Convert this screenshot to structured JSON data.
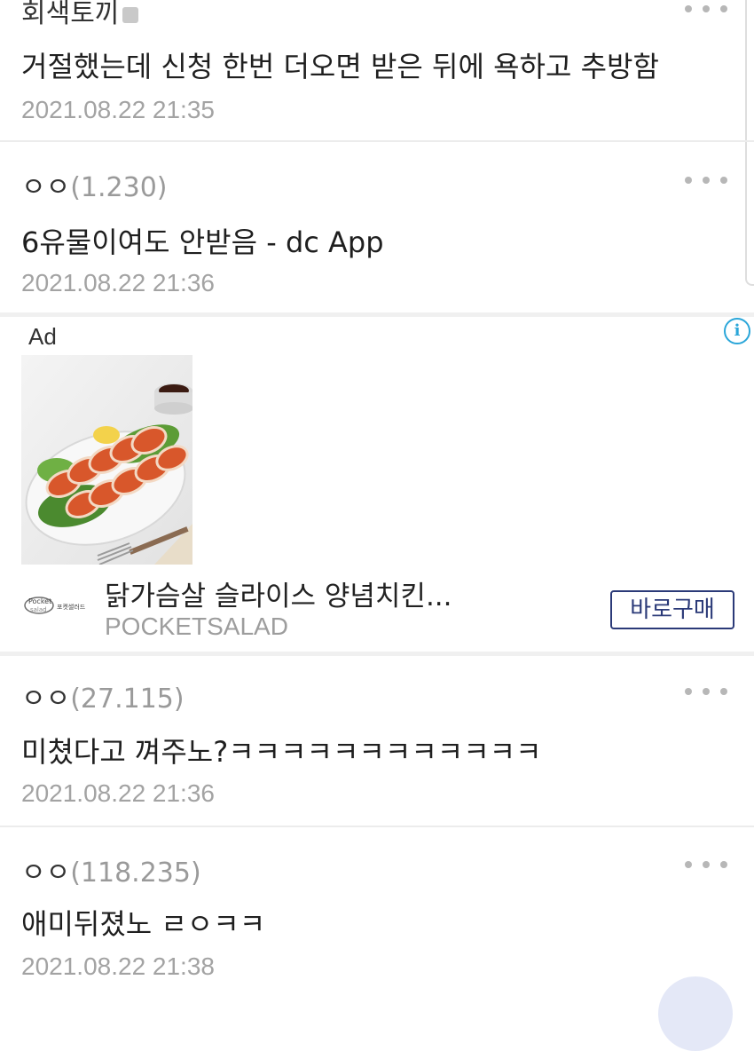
{
  "comments": [
    {
      "author": "회색토끼",
      "ip": "",
      "text": "거절했는데 신청 한번 더오면 받은 뒤에 욕하고 추방함",
      "date": "2021.08.22 21:35"
    },
    {
      "author": "ㅇㅇ",
      "ip": "(1.230)",
      "text": "6유물이여도 안받음 - dc App",
      "date": "2021.08.22 21:36"
    },
    {
      "author": "ㅇㅇ",
      "ip": "(27.115)",
      "text": "미쳤다고 껴주노?ㅋㅋㅋㅋㅋㅋㅋㅋㅋㅋㅋㅋ",
      "date": "2021.08.22 21:36"
    },
    {
      "author": "ㅇㅇ",
      "ip": "(118.235)",
      "text": "애미뒤졌노 ㄹㅇㅋㅋ",
      "date": "2021.08.22 21:38"
    }
  ],
  "ad": {
    "label": "Ad",
    "info_icon": "info-icon",
    "title": "닭가슴살 슬라이스 양념치킨...",
    "brand": "POCKETSALAD",
    "button_label": "바로구매",
    "logo_text": "Pocket salad",
    "logo_subtext": "포켓샐러드"
  },
  "icons": {
    "more": "more-options-icon",
    "badge": "fixed-nick-badge-icon"
  },
  "colors": {
    "accent": "#2b3a78",
    "info": "#2aa6d9",
    "muted": "#a3a3a3"
  }
}
